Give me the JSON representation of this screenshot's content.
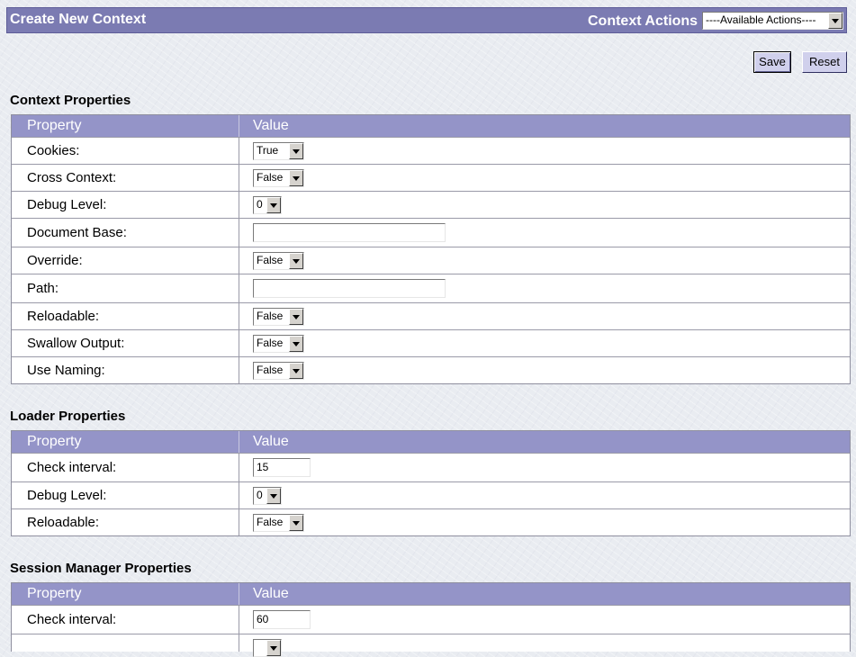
{
  "header": {
    "title": "Create New Context",
    "actions_label": "Context Actions",
    "actions_select": "----Available Actions----"
  },
  "buttons": {
    "save": "Save",
    "reset": "Reset"
  },
  "columns": {
    "property": "Property",
    "value": "Value"
  },
  "context": {
    "title": "Context Properties",
    "rows": [
      {
        "label": "Cookies:",
        "value": "True"
      },
      {
        "label": "Cross Context:",
        "value": "False"
      },
      {
        "label": "Debug Level:",
        "value": "0"
      },
      {
        "label": "Document Base:",
        "value": ""
      },
      {
        "label": "Override:",
        "value": "False"
      },
      {
        "label": "Path:",
        "value": ""
      },
      {
        "label": "Reloadable:",
        "value": "False"
      },
      {
        "label": "Swallow Output:",
        "value": "False"
      },
      {
        "label": "Use Naming:",
        "value": "False"
      }
    ]
  },
  "loader": {
    "title": "Loader Properties",
    "rows": [
      {
        "label": "Check interval:",
        "value": "15"
      },
      {
        "label": "Debug Level:",
        "value": "0"
      },
      {
        "label": "Reloadable:",
        "value": "False"
      }
    ]
  },
  "session": {
    "title": "Session Manager Properties",
    "rows": [
      {
        "label": "Check interval:",
        "value": "60"
      }
    ]
  }
}
